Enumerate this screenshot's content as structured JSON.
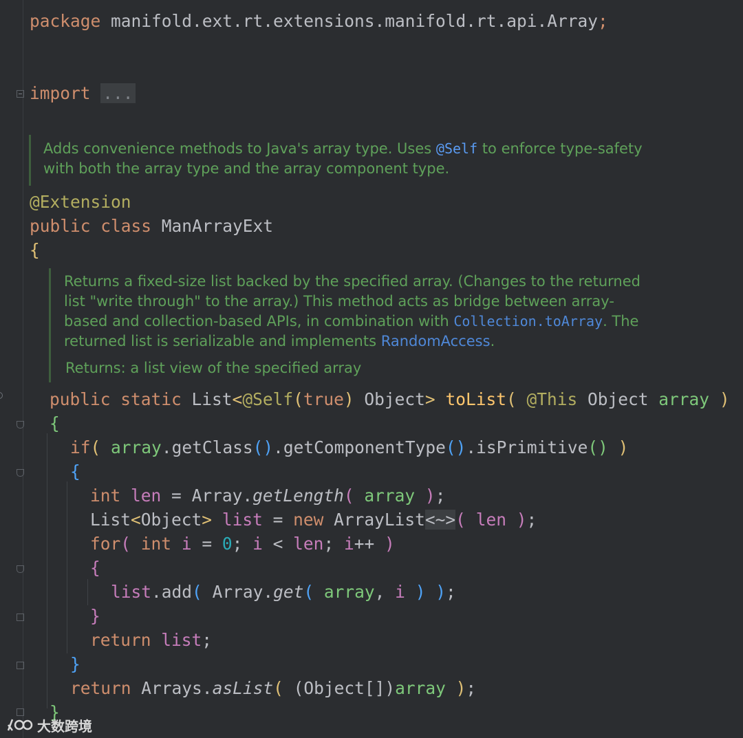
{
  "editor": {
    "package_kw": "package",
    "package_name": "manifold.ext.rt.extensions.manifold.rt.api.Array",
    "semicolon": ";",
    "import_kw": "import",
    "import_folded": "...",
    "class_doc": {
      "line1_a": "Adds convenience methods to Java's array type. Uses ",
      "line1_link": "@Self",
      "line1_b": " to enforce type-safety",
      "line2": "with both the array type and the array component type."
    },
    "annotation": "@Extension",
    "class_decl": {
      "mod": "public class",
      "name": "ManArrayExt"
    },
    "method_doc": {
      "line1": "Returns a fixed-size list backed by the specified array. (Changes to the returned",
      "line2": "list \"write through\" to the array.) This method acts as bridge between array-",
      "line3_a": "based and collection-based APIs, in combination with ",
      "line3_link": "Collection.toArray",
      "line3_b": ". The",
      "line4_a": "returned list is serializable and implements ",
      "line4_link": "RandomAccess",
      "line4_b": ".",
      "returns": "Returns: a list view of the specified array"
    },
    "method_sig": {
      "mods": "public static",
      "ret_type": "List",
      "self_ann": "@Self",
      "self_arg": "true",
      "obj": "Object",
      "name": "toList",
      "this_ann": "@This",
      "param_type": "Object",
      "param": "array"
    },
    "code": {
      "if_kw": "if",
      "array": "array",
      "getClass": ".getClass",
      "getComponentType": ".getComponentType",
      "isPrimitive": ".isPrimitive",
      "int_kw": "int",
      "len": "len",
      "eq": " = ",
      "arrayCls": "Array",
      "getLength": "getLength",
      "listType": "List",
      "objType": "Object",
      "list": "list",
      "new_kw": "new",
      "arrayList": "ArrayList",
      "diamond": "<~>",
      "for_kw": "for",
      "i": "i",
      "zero": "0",
      "lt": " < ",
      "inc": "++",
      "add": ".add",
      "get": "get",
      "return_kw": "return",
      "arraysCls": "Arrays",
      "asList": "asList",
      "cast": "(Object[])"
    }
  },
  "watermark": {
    "text": "大数跨境"
  }
}
